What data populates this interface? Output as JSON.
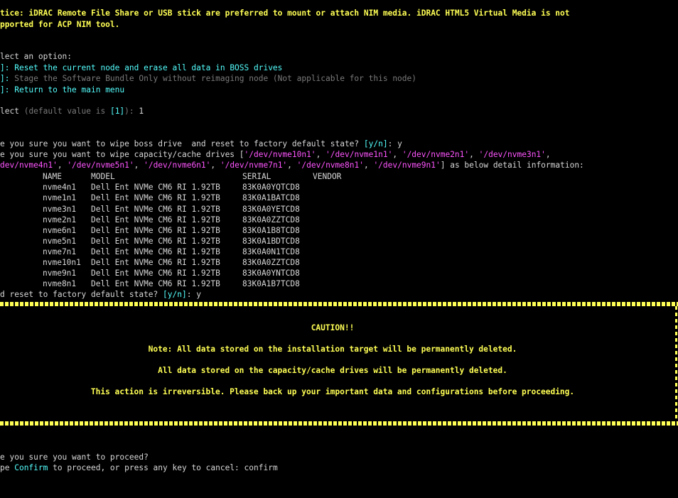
{
  "notice": {
    "line1": "tice: iDRAC Remote File Share or USB stick are preferred to mount or attach NIM media. iDRAC HTML5 Virtual Media is not",
    "line2": "pported for ACP NIM tool."
  },
  "menu": {
    "prompt": "lect an option:",
    "options": [
      {
        "prefix": "]: ",
        "label": "Reset the current node and erase all data in BOSS drives"
      },
      {
        "prefix": "]: ",
        "label": "Stage the Software Bundle Only without reimaging node (Not applicable for this node)"
      },
      {
        "prefix": "]: ",
        "label": "Return to the main menu"
      }
    ],
    "select_label": "lect",
    "select_default_prefix": "(default value is ",
    "select_default_value": "[1]",
    "select_default_suffix": "): ",
    "select_input": "1"
  },
  "boss_prompt": {
    "text": "e you sure you want to wipe boss drive  and reset to factory default state? ",
    "yn": "[y/n]",
    "sep": ": ",
    "answer": "y"
  },
  "capacity_prompt": {
    "start": "e you sure you want to wipe capacity/cache drives [",
    "drives_line1": [
      "'/dev/nvme10n1'",
      "'/dev/nvme1n1'",
      "'/dev/nvme2n1'",
      "'/dev/nvme3n1'"
    ],
    "drives_line2": [
      "dev/nvme4n1'",
      "'/dev/nvme5n1'",
      "'/dev/nvme6n1'",
      "'/dev/nvme7n1'",
      "'/dev/nvme8n1'",
      "'/dev/nvme9n1'"
    ],
    "sep": ", ",
    "line1_end": ",",
    "end": "] as below detail information:"
  },
  "drive_table": {
    "headers": [
      "NAME",
      "MODEL",
      "SERIAL",
      "VENDOR"
    ],
    "rows": [
      [
        "nvme4n1",
        "Dell Ent NVMe CM6 RI 1.92TB",
        "83K0A0YQTCD8"
      ],
      [
        "nvme1n1",
        "Dell Ent NVMe CM6 RI 1.92TB",
        "83K0A1BATCD8"
      ],
      [
        "nvme3n1",
        "Dell Ent NVMe CM6 RI 1.92TB",
        "83K0A0YETCD8"
      ],
      [
        "nvme2n1",
        "Dell Ent NVMe CM6 RI 1.92TB",
        "83K0A0ZZTCD8"
      ],
      [
        "nvme6n1",
        "Dell Ent NVMe CM6 RI 1.92TB",
        "83K0A1B8TCD8"
      ],
      [
        "nvme5n1",
        "Dell Ent NVMe CM6 RI 1.92TB",
        "83K0A1BDTCD8"
      ],
      [
        "nvme7n1",
        "Dell Ent NVMe CM6 RI 1.92TB",
        "83K0A0N1TCD8"
      ],
      [
        "nvme10n1",
        "Dell Ent NVMe CM6 RI 1.92TB",
        "83K0A0ZZTCD8"
      ],
      [
        "nvme9n1",
        "Dell Ent NVMe CM6 RI 1.92TB",
        "83K0A0YNTCD8"
      ],
      [
        "nvme8n1",
        "Dell Ent NVMe CM6 RI 1.92TB",
        "83K0A1B7TCD8"
      ]
    ]
  },
  "reset_prompt": {
    "text": "d reset to factory default state? ",
    "yn": "[y/n]",
    "sep": ": ",
    "answer": "y"
  },
  "caution": {
    "title": "CAUTION!!",
    "line1": "Note: All data stored on the installation target will be permanently deleted.",
    "line2": "All data stored on the capacity/cache drives will be permanently deleted.",
    "line3": "This action is irreversible. Please back up your important data and configurations before proceeding."
  },
  "proceed": {
    "question": "e you sure you want to proceed?",
    "type_prefix": "pe ",
    "confirm_word": "Confirm",
    "type_suffix": " to proceed, or press any key to cancel: ",
    "input": "confirm"
  },
  "colors": {
    "background": "#000000",
    "yellow": "#ffff55",
    "cyan": "#55ffff",
    "magenta": "#ff55ff",
    "gray": "#7a7a7a",
    "text": "#d8d8d8"
  }
}
